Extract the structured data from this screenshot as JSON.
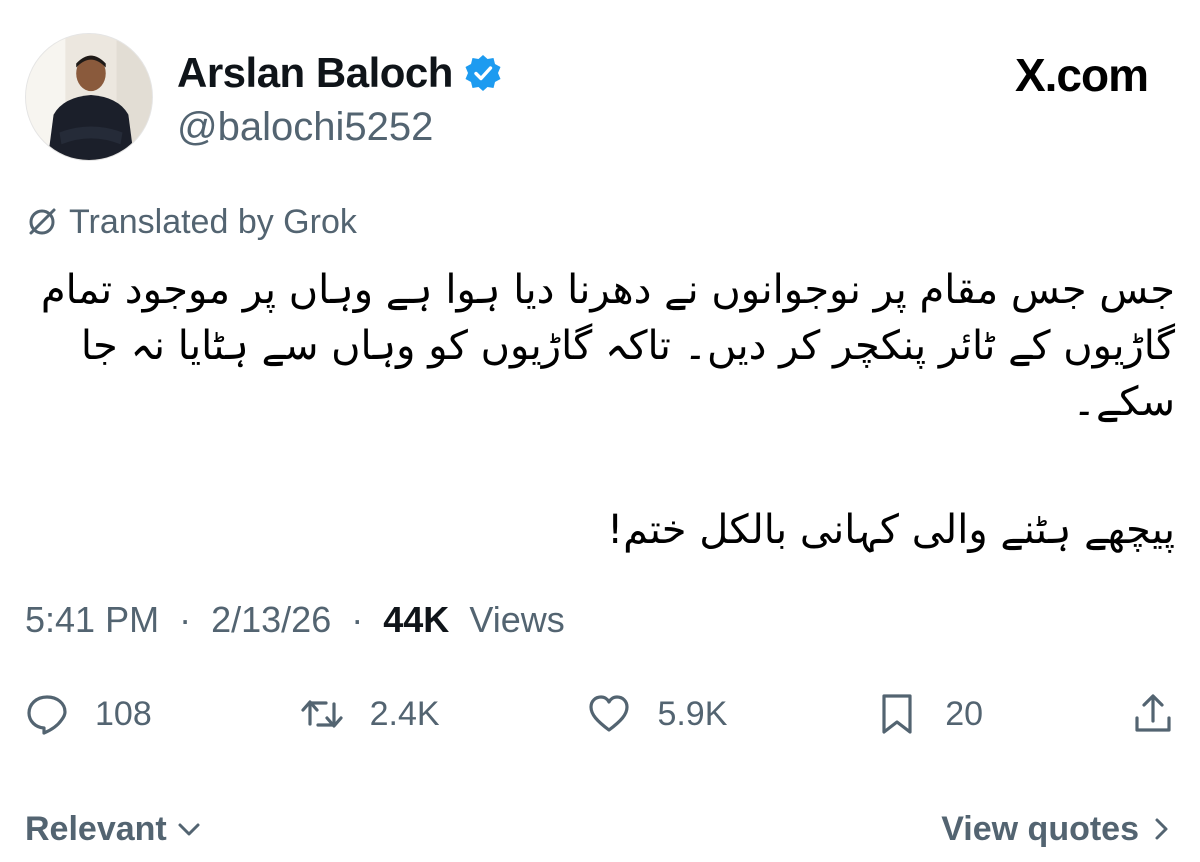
{
  "author": {
    "display_name": "Arslan Baloch",
    "handle": "@balochi5252",
    "verified": true
  },
  "brand": {
    "label": "X.com"
  },
  "translation": {
    "label": "Translated by Grok"
  },
  "tweet": {
    "paragraph1": "جس جس مقام پر نوجوانوں نے دھرنا دیا ہوا ہے وہاں پر موجود تمام گاڑیوں کے ٹائر پنکچر کر دیں۔ تاکہ گاڑیوں کو وہاں سے ہٹایا نہ جا سکے۔",
    "paragraph2": "پیچھے ہٹنے والی کہانی بالکل ختم!"
  },
  "meta": {
    "time": "5:41 PM",
    "date": "2/13/26",
    "separator": "·",
    "views_count": "44K",
    "views_label": "Views"
  },
  "actions": {
    "replies": "108",
    "reposts": "2.4K",
    "likes": "5.9K",
    "bookmarks": "20"
  },
  "footer": {
    "sort_label": "Relevant",
    "quotes_label": "View quotes"
  },
  "colors": {
    "verified": "#1d9bf0",
    "secondary_text": "#536471",
    "primary_text": "#0f1419"
  }
}
